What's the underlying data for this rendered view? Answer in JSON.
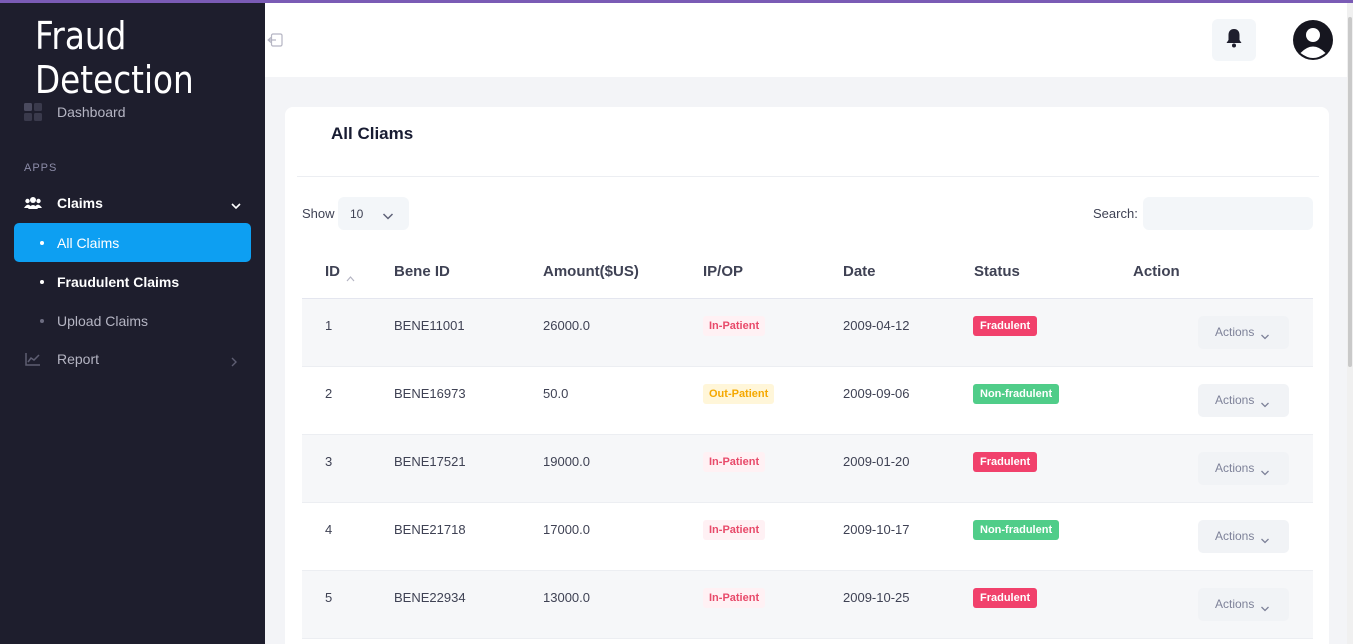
{
  "brand": "Fraud Detection",
  "sidebar": {
    "dashboard": "Dashboard",
    "apps_heading": "APPS",
    "claims": "Claims",
    "sub_items": [
      "All Claims",
      "Fraudulent Claims",
      "Upload Claims"
    ],
    "report": "Report"
  },
  "card": {
    "title": "All Cliams",
    "show_label": "Show",
    "page_size": "10",
    "search_label": "Search:",
    "search_value": ""
  },
  "table": {
    "headers": [
      "ID",
      "Bene ID",
      "Amount($US)",
      "IP/OP",
      "Date",
      "Status",
      "Action"
    ],
    "rows": [
      {
        "id": "1",
        "bene": "BENE11001",
        "amount": "26000.0",
        "ipop": "In-Patient",
        "date": "2009-04-12",
        "status": "Fradulent",
        "action": "Actions"
      },
      {
        "id": "2",
        "bene": "BENE16973",
        "amount": "50.0",
        "ipop": "Out-Patient",
        "date": "2009-09-06",
        "status": "Non-fradulent",
        "action": "Actions"
      },
      {
        "id": "3",
        "bene": "BENE17521",
        "amount": "19000.0",
        "ipop": "In-Patient",
        "date": "2009-01-20",
        "status": "Fradulent",
        "action": "Actions"
      },
      {
        "id": "4",
        "bene": "BENE21718",
        "amount": "17000.0",
        "ipop": "In-Patient",
        "date": "2009-10-17",
        "status": "Non-fradulent",
        "action": "Actions"
      },
      {
        "id": "5",
        "bene": "BENE22934",
        "amount": "13000.0",
        "ipop": "In-Patient",
        "date": "2009-10-25",
        "status": "Fradulent",
        "action": "Actions"
      }
    ]
  },
  "colors": {
    "sidebar_bg": "#1e1e2d",
    "accent": "#0d9ff2",
    "fraud": "#f1416c",
    "non_fraud": "#50cd89",
    "in_patient": "#e84a6a",
    "out_patient": "#f5a800"
  },
  "icons": {
    "dashboard": "dashboard-icon",
    "claims": "users-icon",
    "report": "chart-icon",
    "notifications": "bell-icon",
    "user": "user-avatar-icon",
    "collapse": "collapse-sidebar-icon"
  }
}
